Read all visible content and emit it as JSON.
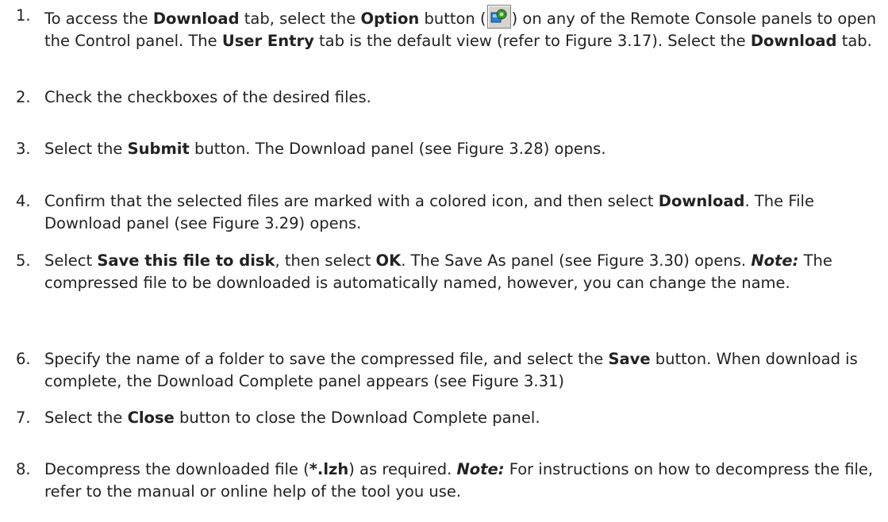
{
  "steps": [
    {
      "num": "1.",
      "parts": [
        {
          "t": "To access the "
        },
        {
          "b": "Download"
        },
        {
          "t": " tab, select the "
        },
        {
          "b": "Option"
        },
        {
          "t": " button ("
        },
        {
          "icon": "option-icon"
        },
        {
          "t": ") on any of the Remote Console panels to open the Control panel. The "
        },
        {
          "b": "User Entry"
        },
        {
          "t": " tab is the default view (refer to Figure 3.17). Select the "
        },
        {
          "b": "Download"
        },
        {
          "t": " tab."
        }
      ]
    },
    {
      "num": "2.",
      "parts": [
        {
          "t": "Check the checkboxes of the desired files."
        }
      ]
    },
    {
      "num": "3.",
      "parts": [
        {
          "t": "Select the "
        },
        {
          "b": "Submit"
        },
        {
          "t": " button. The Download panel (see Figure 3.28) opens."
        }
      ]
    },
    {
      "num": "4.",
      "parts": [
        {
          "t": "Confirm that the selected files are marked with a colored icon, and then select "
        },
        {
          "b": "Download"
        },
        {
          "t": ". The File Download panel (see Figure 3.29) opens."
        }
      ]
    },
    {
      "num": "5.",
      "parts": [
        {
          "t": "Select "
        },
        {
          "b": "Save this file to disk"
        },
        {
          "t": ", then select "
        },
        {
          "b": "OK"
        },
        {
          "t": ". The Save As panel (see Figure 3.30) opens. "
        },
        {
          "note": "Note:"
        },
        {
          "t": " The compressed file to be downloaded is automatically named, however, you can change the name."
        }
      ]
    },
    {
      "num": "6.",
      "parts": [
        {
          "t": "Specify the name of a folder to save the compressed file, and select the "
        },
        {
          "b": "Save"
        },
        {
          "t": " button. When download is complete, the Download Complete panel appears (see Figure 3.31)"
        }
      ]
    },
    {
      "num": "7.",
      "parts": [
        {
          "t": " Select the "
        },
        {
          "b": "Close"
        },
        {
          "t": " button to close the Download Complete panel."
        }
      ]
    },
    {
      "num": "8.",
      "parts": [
        {
          "t": "Decompress the downloaded file ("
        },
        {
          "b": "*.lzh"
        },
        {
          "t": ") as required. "
        },
        {
          "note": "Note:"
        },
        {
          "t": " For instructions on how to decompress the file, refer to the manual or online help of the tool you use."
        }
      ]
    }
  ]
}
